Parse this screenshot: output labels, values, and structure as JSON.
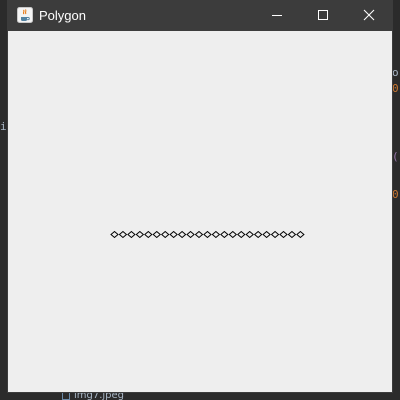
{
  "window": {
    "title": "Polygon",
    "app_icon": "java-cup-icon",
    "controls": {
      "minimize": "minimize-icon",
      "maximize": "maximize-icon",
      "close": "close-icon"
    }
  },
  "canvas": {
    "background": "#eeeeee",
    "stroke_color": "#000000",
    "shape": "diamond-icon",
    "diamond_count": 23
  },
  "background_app": {
    "bottom_file_label": "img7.jpeg",
    "accent_orange": "#cc7832",
    "accent_purple": "#9876aa"
  }
}
